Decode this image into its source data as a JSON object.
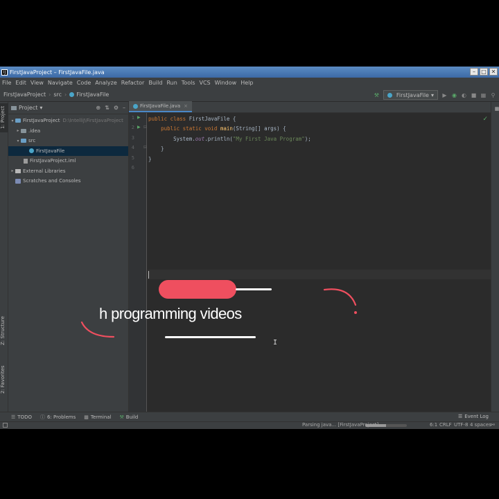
{
  "window": {
    "title": "FirstJavaProject – FirstJavaFile.java",
    "app_icon_label": "IJ"
  },
  "menu": [
    "File",
    "Edit",
    "View",
    "Navigate",
    "Code",
    "Analyze",
    "Refactor",
    "Build",
    "Run",
    "Tools",
    "VCS",
    "Window",
    "Help"
  ],
  "breadcrumb": {
    "project": "FirstJavaProject",
    "folder": "src",
    "file": "FirstJavaFile"
  },
  "run_config": {
    "label": "FirstJavaFile",
    "dropdown": "▾"
  },
  "left_tabs": {
    "project": "1: Project",
    "structure": "Z: Structure",
    "favorites": "2: Favorites"
  },
  "project_panel": {
    "title": "Project",
    "dropdown": "▾",
    "tree": {
      "root_name": "FirstJavaProject",
      "root_path": "D:\\IntelliJ\\FirstJavaProject",
      "idea": ".idea",
      "src": "src",
      "file": "FirstJavaFile",
      "iml": "FirstJavaProject.iml",
      "libraries": "External Libraries",
      "scratches": "Scratches and Consoles"
    }
  },
  "editor": {
    "tab_label": "FirstJavaFile.java",
    "line_numbers": [
      "1",
      "2",
      "3",
      "4",
      "5",
      "6"
    ],
    "code": {
      "l1_kw": "public class ",
      "l1_rest": "FirstJavaFile {",
      "l2_indent": "    ",
      "l2_kw": "public static void ",
      "l2_fn": "main",
      "l2_rest": "(String[] args) {",
      "l3_indent": "        ",
      "l3_pre": "System.",
      "l3_fld": "out",
      "l3_mid": ".println(",
      "l3_str": "\"My First Java Program\"",
      "l3_end": ");",
      "l4": "    }",
      "l5": "}"
    }
  },
  "overlay": {
    "text": "h programming videos",
    "accent_color": "#ef4f5f"
  },
  "bottom_tools": {
    "todo": "TODO",
    "problems": "6: Problems",
    "terminal": "Terminal",
    "build": "Build",
    "event_log": "Event Log"
  },
  "status": {
    "parsing": "Parsing java... [FirstJavaProject]",
    "progress_percent": 50,
    "position": "6:1",
    "line_sep": "CRLF",
    "encoding": "UTF-8",
    "indent": "4 spaces"
  }
}
